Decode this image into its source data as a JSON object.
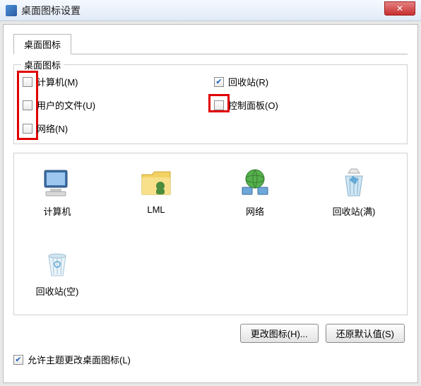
{
  "window": {
    "title": "桌面图标设置"
  },
  "tab": {
    "label": "桌面图标"
  },
  "group": {
    "title": "桌面图标"
  },
  "checks": {
    "computer": {
      "label": "计算机(M)",
      "checked": false
    },
    "recycle": {
      "label": "回收站(R)",
      "checked": true
    },
    "userfiles": {
      "label": "用户的文件(U)",
      "checked": false
    },
    "control": {
      "label": "控制面板(O)",
      "checked": false
    },
    "network": {
      "label": "网络(N)",
      "checked": false
    }
  },
  "icons": {
    "computer": {
      "label": "计算机"
    },
    "userfolder": {
      "label": "LML"
    },
    "network": {
      "label": "网络"
    },
    "recycle_full": {
      "label": "回收站(满)"
    },
    "recycle_empty": {
      "label": "回收站(空)"
    }
  },
  "buttons": {
    "change_icon": "更改图标(H)...",
    "restore_default": "还原默认值(S)"
  },
  "allow_theme": {
    "label": "允许主题更改桌面图标(L)",
    "checked": true
  }
}
